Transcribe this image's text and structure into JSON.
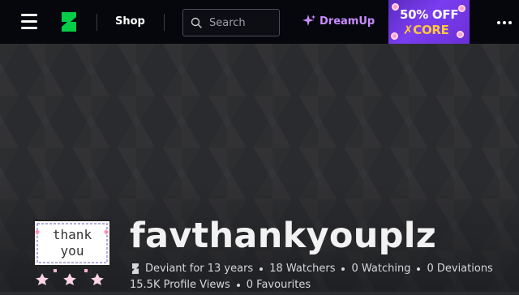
{
  "topbar": {
    "shop_label": "Shop",
    "search_placeholder": "Search",
    "dreamup_label": "DreamUp",
    "ad": {
      "line1": "50% OFF",
      "line2": "✗CORE"
    }
  },
  "profile": {
    "username": "favthankyouplz",
    "avatar_text": [
      "thank",
      "you"
    ],
    "deviant_since": "Deviant for 13 years",
    "watchers": "18 Watchers",
    "watching": "0 Watching",
    "deviations": "0 Deviations",
    "profile_views": "15.5K Profile Views",
    "favourites": "0 Favourites"
  },
  "colors": {
    "topbar_bg": "#06070d",
    "brand_green": "#05cc47",
    "dreamup_purple": "#c98bff",
    "ad_yellow": "#ffc83a",
    "banner_bg": "#2a2b2e"
  },
  "icons": [
    "menu-icon",
    "deviantart-logo-icon",
    "search-icon",
    "sparkle-icon",
    "more-icon"
  ]
}
